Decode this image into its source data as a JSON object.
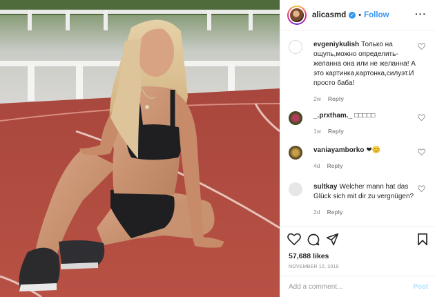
{
  "post": {
    "username": "alicasmd",
    "follow_label": "Follow",
    "separator": "•",
    "more_label": "···",
    "likes": "57,688 likes",
    "date": "NOVEMBER 10, 2019",
    "comment_placeholder": "Add a comment...",
    "post_label": "Post"
  },
  "comments": [
    {
      "user": "evgeniykulish",
      "text": "Только на ощупь,можно определить- желанна она или не желанна! А это картинка,картонка,силуэт.И просто баба!",
      "time": "2w",
      "reply": "Reply",
      "avatar_color": "#ffffff"
    },
    {
      "user": "_.prxtham._",
      "text": "□□□□□",
      "time": "1w",
      "reply": "Reply",
      "avatar_color": "#6d2f4a"
    },
    {
      "user": "vaniayamborko",
      "text": "❤😊",
      "time": "4d",
      "reply": "Reply",
      "avatar_color": "#8a6a2c"
    },
    {
      "user": "sultkay",
      "text": "Welcher mann hat das Glück sich mit dir zu vergnügen?",
      "time": "2d",
      "reply": "Reply",
      "avatar_color": "#dcdcdc"
    }
  ],
  "colors": {
    "accent": "#3897f0",
    "post_disabled": "#b2dffc",
    "track": "#b44a3e"
  },
  "icons": [
    "heart-icon",
    "comment-icon",
    "share-icon",
    "bookmark-icon",
    "verified-icon",
    "more-icon"
  ]
}
